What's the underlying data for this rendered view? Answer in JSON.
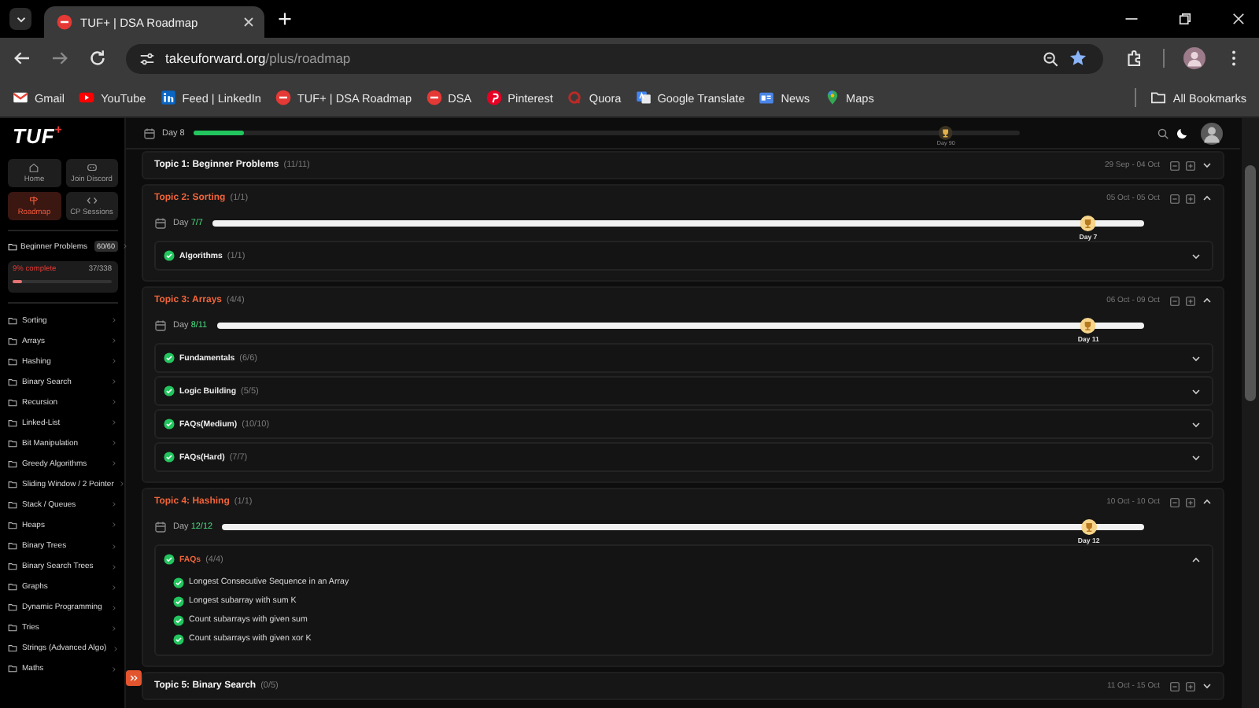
{
  "browser": {
    "tab_title": "TUF+ | DSA Roadmap",
    "url_domain": "takeuforward.org",
    "url_path": "/plus/roadmap",
    "bookmarks": [
      {
        "label": "Gmail",
        "kind": "gmail"
      },
      {
        "label": "YouTube",
        "kind": "youtube"
      },
      {
        "label": "Feed | LinkedIn",
        "kind": "linkedin"
      },
      {
        "label": "TUF+ | DSA Roadmap",
        "kind": "tuf"
      },
      {
        "label": "DSA",
        "kind": "tuf"
      },
      {
        "label": "Pinterest",
        "kind": "pinterest"
      },
      {
        "label": "Quora",
        "kind": "quora"
      },
      {
        "label": "Google Translate",
        "kind": "translate"
      },
      {
        "label": "News",
        "kind": "news"
      },
      {
        "label": "Maps",
        "kind": "maps"
      }
    ],
    "all_bookmarks": "All Bookmarks"
  },
  "sidebar": {
    "logo": "TUF",
    "logo_mark": "+",
    "nav": [
      {
        "label": "Home",
        "kind": "home",
        "selected": false
      },
      {
        "label": "Join Discord",
        "kind": "discord",
        "selected": false
      },
      {
        "label": "Roadmap",
        "kind": "roadmap",
        "selected": true
      },
      {
        "label": "CP Sessions",
        "kind": "sessions",
        "selected": false
      }
    ],
    "beginner": {
      "label": "Beginner Problems",
      "badge": "60/60"
    },
    "progress": {
      "label": "9% complete",
      "count": "37/338",
      "level": 0.09
    },
    "categories": [
      "Sorting",
      "Arrays",
      "Hashing",
      "Binary Search",
      "Recursion",
      "Linked-List",
      "Bit Manipulation",
      "Greedy Algorithms",
      "Sliding Window / 2 Pointer",
      "Stack / Queues",
      "Heaps",
      "Binary Trees",
      "Binary Search Trees",
      "Graphs",
      "Dynamic Programming",
      "Tries",
      "Strings (Advanced Algo)",
      "Maths"
    ]
  },
  "header": {
    "day": "Day 8",
    "level": 0.06,
    "goal": "Day 90"
  },
  "topics": [
    {
      "title": "Topic 1: Beginner Problems",
      "count": "(11/11)",
      "dates": "29 Sep - 04 Oct",
      "expanded": false
    },
    {
      "title": "Topic 2: Sorting",
      "count": "(1/1)",
      "dates": "05 Oct - 05 Oct",
      "expanded": true,
      "day_word": "Day",
      "day_value": "7/7",
      "level": 0.94,
      "goal": "Day 7",
      "sections": [
        {
          "title": "Algorithms",
          "count": "(1/1)",
          "done": true,
          "expanded": false
        }
      ]
    },
    {
      "title": "Topic 3: Arrays",
      "count": "(4/4)",
      "dates": "06 Oct - 09 Oct",
      "expanded": true,
      "day_word": "Day",
      "day_value": "8/11",
      "level": 0.94,
      "goal": "Day 11",
      "sections": [
        {
          "title": "Fundamentals",
          "count": "(6/6)",
          "done": true,
          "expanded": false
        },
        {
          "title": "Logic Building",
          "count": "(5/5)",
          "done": true,
          "expanded": false
        },
        {
          "title": "FAQs(Medium)",
          "count": "(10/10)",
          "done": true,
          "expanded": false
        },
        {
          "title": "FAQs(Hard)",
          "count": "(7/7)",
          "done": true,
          "expanded": false
        }
      ]
    },
    {
      "title": "Topic 4: Hashing",
      "count": "(1/1)",
      "dates": "10 Oct - 10 Oct",
      "expanded": true,
      "day_word": "Day",
      "day_value": "12/12",
      "level": 0.94,
      "goal": "Day 12",
      "sections": [
        {
          "title": "FAQs",
          "count": "(4/4)",
          "done": true,
          "expanded": true,
          "problems": [
            {
              "title": "Longest Consecutive Sequence in an Array",
              "done": true
            },
            {
              "title": "Longest subarray with sum K",
              "done": true
            },
            {
              "title": "Count subarrays with given sum",
              "done": true
            },
            {
              "title": "Count subarrays with given xor K",
              "done": true
            }
          ]
        }
      ]
    },
    {
      "title": "Topic 5: Binary Search",
      "count": "(0/5)",
      "dates": "11 Oct - 15 Oct",
      "expanded": false
    }
  ]
}
